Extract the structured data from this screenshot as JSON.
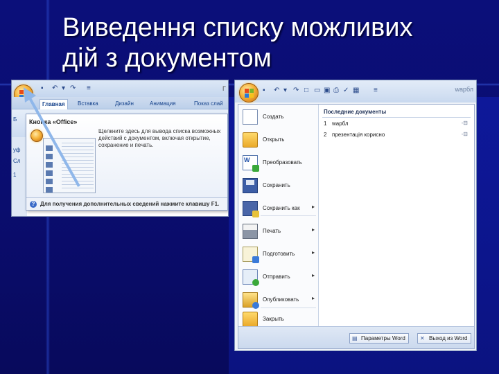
{
  "slide": {
    "title_line1": "Виведення списку можливих",
    "title_line2": "дій з документом"
  },
  "screenshot1": {
    "tabs": [
      "Главная",
      "Вставка",
      "Дизайн",
      "Анимация",
      "Показ слай"
    ],
    "title_fragment": "Г",
    "sidebar_labels": [
      "Б",
      "уф",
      "Сл",
      "1"
    ],
    "tooltip": {
      "title": "Кнопка «Office»",
      "description": "Щелкните здесь для вывода списка возможных действий с документом, включая открытие, сохранение и печать.",
      "help": "Для получения дополнительных сведений нажмите клавишу F1."
    }
  },
  "screenshot2": {
    "window_title": "wapбл",
    "menu_items": [
      {
        "label": "Создать",
        "icon": "new-document-icon",
        "submenu": false
      },
      {
        "label": "Открыть",
        "icon": "open-folder-icon",
        "submenu": false
      },
      {
        "label": "Преобразовать",
        "icon": "convert-icon",
        "submenu": false
      },
      {
        "label": "Сохранить",
        "icon": "save-disk-icon",
        "submenu": false
      },
      {
        "label": "Сохранить как",
        "icon": "save-as-icon",
        "submenu": true
      },
      {
        "label": "Печать",
        "icon": "printer-icon",
        "submenu": true
      },
      {
        "label": "Подготовить",
        "icon": "prepare-icon",
        "submenu": true
      },
      {
        "label": "Отправить",
        "icon": "send-icon",
        "submenu": true
      },
      {
        "label": "Опубликовать",
        "icon": "publish-icon",
        "submenu": true
      },
      {
        "label": "Закрыть",
        "icon": "close-folder-icon",
        "submenu": false
      }
    ],
    "submenu_glyph": "▸",
    "recent_title": "Последние документы",
    "recent": [
      {
        "num": "1",
        "name": "wapбл",
        "pin": "-⊟"
      },
      {
        "num": "2",
        "name": "презентація корисно",
        "pin": "-⊟"
      }
    ],
    "options_button": "Параметры Word",
    "exit_button": "Выход из Word"
  },
  "colors": {
    "slide_background": "#0b0f7a",
    "title_text": "#ffffff",
    "office_orb": "#f6b43a",
    "ribbon_blue": "#c9d9ef"
  }
}
